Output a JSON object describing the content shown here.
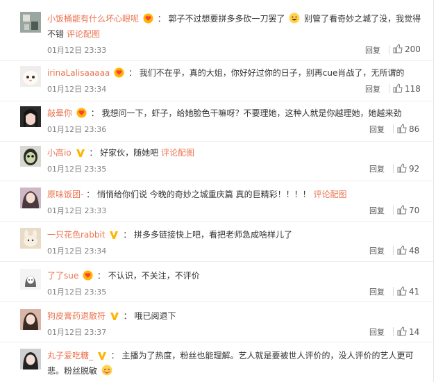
{
  "comments": [
    {
      "user": "小饭桶能有什么坏心眼呢",
      "badge": "heart",
      "text": "：  郭子不过想要拼多多砍一刀罢了",
      "emoji": "grin",
      "text2": "别管了看奇妙之城了没，我觉得不错",
      "link": "评论配图",
      "time": "01月12日 23:33",
      "reply": "回复",
      "likes": "200"
    },
    {
      "user": "irinaLalisaaaaa",
      "badge": "heart",
      "text": "：  我们不在乎，真的大姐，你好好过你的日子，别再cue肖战了，无所谓的",
      "time": "01月12日 23:34",
      "reply": "回复",
      "likes": "118"
    },
    {
      "user": "敲晕你",
      "badge": "heart",
      "text": "：  我想问一下，虾子，给她脸色干嘛呀？不要理她，这种人就是你越理她，她越来劲",
      "time": "01月12日 23:36",
      "reply": "回复",
      "likes": "86"
    },
    {
      "user": "小高io",
      "badge": "v",
      "text": "：  好家伙，随她吧 ",
      "link": "评论配图",
      "time": "01月12日 23:35",
      "reply": "回复",
      "likes": "92"
    },
    {
      "user": "原味饭团-",
      "text": "：  悄悄给你们说 今晚的奇妙之城重庆篇 真的巨精彩！！！！ ",
      "link": "评论配图",
      "time": "01月12日 23:33",
      "reply": "回复",
      "likes": "70"
    },
    {
      "user": "一只花色rabbit",
      "badge": "v",
      "text": "：  拼多多链接快上吧，看把老师急成啥样儿了",
      "time": "01月12日 23:34",
      "reply": "回复",
      "likes": "48"
    },
    {
      "user": "了了sue",
      "badge": "heart",
      "text": "：  不认识，不关注，不评价",
      "time": "01月12日 23:35",
      "reply": "回复",
      "likes": "41"
    },
    {
      "user": "狗皮膏药退散符",
      "badge": "v",
      "text": "：  哦已阅退下",
      "time": "01月12日 23:37",
      "reply": "回复",
      "likes": "14"
    },
    {
      "user": "丸子爱吃糖_",
      "badge": "v",
      "text": "：  主播为了热度，粉丝也能理解。艺人就是要被世人评价的，没人评价的艺人更可悲。粉丝脱敏",
      "emoji": "blush",
      "time": "",
      "reply": "",
      "likes": ""
    }
  ],
  "colors": {
    "username": "#eb7350",
    "text": "#333333",
    "meta": "#808080"
  }
}
